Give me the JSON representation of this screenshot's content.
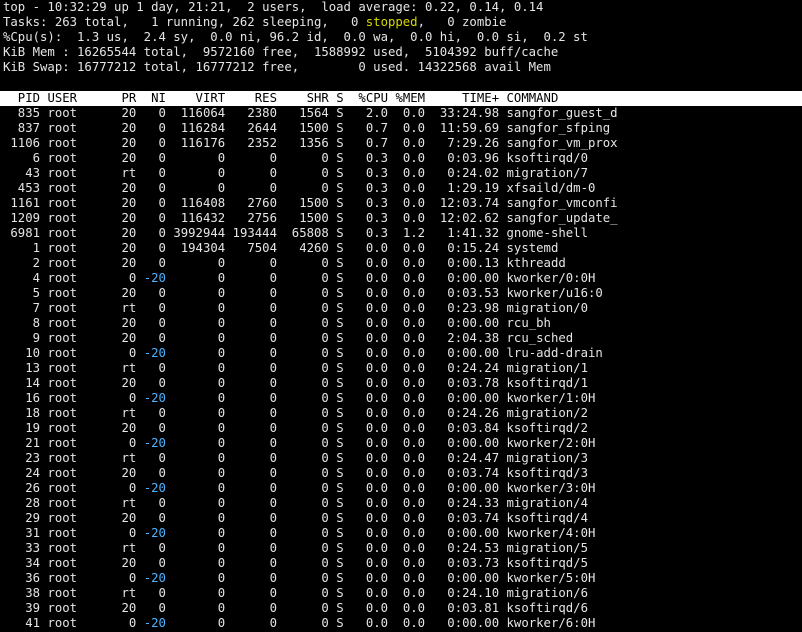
{
  "summary": {
    "line1": "top - 10:32:29 up 1 day, 21:21,  2 users,  load average: 0.22, 0.14, 0.14",
    "tasks_pre": "Tasks: 263 total,   1 running, 262 sleeping,   0 ",
    "tasks_stopped": "stopped",
    "tasks_post": ",   0 zombie",
    "cpu": "%Cpu(s):  1.3 us,  2.4 sy,  0.0 ni, 96.2 id,  0.0 wa,  0.0 hi,  0.0 si,  0.2 st",
    "mem": "KiB Mem : 16265544 total,  9572160 free,  1588992 used,  5104392 buff/cache",
    "swap": "KiB Swap: 16777212 total, 16777212 free,        0 used. 14322568 avail Mem"
  },
  "colors": {
    "stopped": "#d8d800",
    "negative_nice": "#4fb3ff",
    "header_bg": "#ffffff",
    "background": "#000000",
    "text": "#e5e5e5"
  },
  "columns": [
    "PID",
    "USER",
    "PR",
    "NI",
    "VIRT",
    "RES",
    "SHR",
    "S",
    "%CPU",
    "%MEM",
    "TIME+",
    "COMMAND"
  ],
  "processes": [
    {
      "pid": "835",
      "user": "root",
      "pr": "20",
      "ni": "0",
      "virt": "116064",
      "res": "2380",
      "shr": "1564",
      "s": "S",
      "cpu": "2.0",
      "mem": "0.0",
      "time": "33:24.98",
      "cmd": "sangfor_guest_d"
    },
    {
      "pid": "837",
      "user": "root",
      "pr": "20",
      "ni": "0",
      "virt": "116284",
      "res": "2644",
      "shr": "1500",
      "s": "S",
      "cpu": "0.7",
      "mem": "0.0",
      "time": "11:59.69",
      "cmd": "sangfor_sfping"
    },
    {
      "pid": "1106",
      "user": "root",
      "pr": "20",
      "ni": "0",
      "virt": "116176",
      "res": "2352",
      "shr": "1356",
      "s": "S",
      "cpu": "0.7",
      "mem": "0.0",
      "time": "7:29.26",
      "cmd": "sangfor_vm_prox"
    },
    {
      "pid": "6",
      "user": "root",
      "pr": "20",
      "ni": "0",
      "virt": "0",
      "res": "0",
      "shr": "0",
      "s": "S",
      "cpu": "0.3",
      "mem": "0.0",
      "time": "0:03.96",
      "cmd": "ksoftirqd/0"
    },
    {
      "pid": "43",
      "user": "root",
      "pr": "rt",
      "ni": "0",
      "virt": "0",
      "res": "0",
      "shr": "0",
      "s": "S",
      "cpu": "0.3",
      "mem": "0.0",
      "time": "0:24.02",
      "cmd": "migration/7"
    },
    {
      "pid": "453",
      "user": "root",
      "pr": "20",
      "ni": "0",
      "virt": "0",
      "res": "0",
      "shr": "0",
      "s": "S",
      "cpu": "0.3",
      "mem": "0.0",
      "time": "1:29.19",
      "cmd": "xfsaild/dm-0"
    },
    {
      "pid": "1161",
      "user": "root",
      "pr": "20",
      "ni": "0",
      "virt": "116408",
      "res": "2760",
      "shr": "1500",
      "s": "S",
      "cpu": "0.3",
      "mem": "0.0",
      "time": "12:03.74",
      "cmd": "sangfor_vmconfi"
    },
    {
      "pid": "1209",
      "user": "root",
      "pr": "20",
      "ni": "0",
      "virt": "116432",
      "res": "2756",
      "shr": "1500",
      "s": "S",
      "cpu": "0.3",
      "mem": "0.0",
      "time": "12:02.62",
      "cmd": "sangfor_update_"
    },
    {
      "pid": "6981",
      "user": "root",
      "pr": "20",
      "ni": "0",
      "virt": "3992944",
      "res": "193444",
      "shr": "65808",
      "s": "S",
      "cpu": "0.3",
      "mem": "1.2",
      "time": "1:41.32",
      "cmd": "gnome-shell"
    },
    {
      "pid": "1",
      "user": "root",
      "pr": "20",
      "ni": "0",
      "virt": "194304",
      "res": "7504",
      "shr": "4260",
      "s": "S",
      "cpu": "0.0",
      "mem": "0.0",
      "time": "0:15.24",
      "cmd": "systemd"
    },
    {
      "pid": "2",
      "user": "root",
      "pr": "20",
      "ni": "0",
      "virt": "0",
      "res": "0",
      "shr": "0",
      "s": "S",
      "cpu": "0.0",
      "mem": "0.0",
      "time": "0:00.13",
      "cmd": "kthreadd"
    },
    {
      "pid": "4",
      "user": "root",
      "pr": "0",
      "ni": "-20",
      "virt": "0",
      "res": "0",
      "shr": "0",
      "s": "S",
      "cpu": "0.0",
      "mem": "0.0",
      "time": "0:00.00",
      "cmd": "kworker/0:0H"
    },
    {
      "pid": "5",
      "user": "root",
      "pr": "20",
      "ni": "0",
      "virt": "0",
      "res": "0",
      "shr": "0",
      "s": "S",
      "cpu": "0.0",
      "mem": "0.0",
      "time": "0:03.53",
      "cmd": "kworker/u16:0"
    },
    {
      "pid": "7",
      "user": "root",
      "pr": "rt",
      "ni": "0",
      "virt": "0",
      "res": "0",
      "shr": "0",
      "s": "S",
      "cpu": "0.0",
      "mem": "0.0",
      "time": "0:23.98",
      "cmd": "migration/0"
    },
    {
      "pid": "8",
      "user": "root",
      "pr": "20",
      "ni": "0",
      "virt": "0",
      "res": "0",
      "shr": "0",
      "s": "S",
      "cpu": "0.0",
      "mem": "0.0",
      "time": "0:00.00",
      "cmd": "rcu_bh"
    },
    {
      "pid": "9",
      "user": "root",
      "pr": "20",
      "ni": "0",
      "virt": "0",
      "res": "0",
      "shr": "0",
      "s": "S",
      "cpu": "0.0",
      "mem": "0.0",
      "time": "2:04.38",
      "cmd": "rcu_sched"
    },
    {
      "pid": "10",
      "user": "root",
      "pr": "0",
      "ni": "-20",
      "virt": "0",
      "res": "0",
      "shr": "0",
      "s": "S",
      "cpu": "0.0",
      "mem": "0.0",
      "time": "0:00.00",
      "cmd": "lru-add-drain"
    },
    {
      "pid": "13",
      "user": "root",
      "pr": "rt",
      "ni": "0",
      "virt": "0",
      "res": "0",
      "shr": "0",
      "s": "S",
      "cpu": "0.0",
      "mem": "0.0",
      "time": "0:24.24",
      "cmd": "migration/1"
    },
    {
      "pid": "14",
      "user": "root",
      "pr": "20",
      "ni": "0",
      "virt": "0",
      "res": "0",
      "shr": "0",
      "s": "S",
      "cpu": "0.0",
      "mem": "0.0",
      "time": "0:03.78",
      "cmd": "ksoftirqd/1"
    },
    {
      "pid": "16",
      "user": "root",
      "pr": "0",
      "ni": "-20",
      "virt": "0",
      "res": "0",
      "shr": "0",
      "s": "S",
      "cpu": "0.0",
      "mem": "0.0",
      "time": "0:00.00",
      "cmd": "kworker/1:0H"
    },
    {
      "pid": "18",
      "user": "root",
      "pr": "rt",
      "ni": "0",
      "virt": "0",
      "res": "0",
      "shr": "0",
      "s": "S",
      "cpu": "0.0",
      "mem": "0.0",
      "time": "0:24.26",
      "cmd": "migration/2"
    },
    {
      "pid": "19",
      "user": "root",
      "pr": "20",
      "ni": "0",
      "virt": "0",
      "res": "0",
      "shr": "0",
      "s": "S",
      "cpu": "0.0",
      "mem": "0.0",
      "time": "0:03.84",
      "cmd": "ksoftirqd/2"
    },
    {
      "pid": "21",
      "user": "root",
      "pr": "0",
      "ni": "-20",
      "virt": "0",
      "res": "0",
      "shr": "0",
      "s": "S",
      "cpu": "0.0",
      "mem": "0.0",
      "time": "0:00.00",
      "cmd": "kworker/2:0H"
    },
    {
      "pid": "23",
      "user": "root",
      "pr": "rt",
      "ni": "0",
      "virt": "0",
      "res": "0",
      "shr": "0",
      "s": "S",
      "cpu": "0.0",
      "mem": "0.0",
      "time": "0:24.47",
      "cmd": "migration/3"
    },
    {
      "pid": "24",
      "user": "root",
      "pr": "20",
      "ni": "0",
      "virt": "0",
      "res": "0",
      "shr": "0",
      "s": "S",
      "cpu": "0.0",
      "mem": "0.0",
      "time": "0:03.74",
      "cmd": "ksoftirqd/3"
    },
    {
      "pid": "26",
      "user": "root",
      "pr": "0",
      "ni": "-20",
      "virt": "0",
      "res": "0",
      "shr": "0",
      "s": "S",
      "cpu": "0.0",
      "mem": "0.0",
      "time": "0:00.00",
      "cmd": "kworker/3:0H"
    },
    {
      "pid": "28",
      "user": "root",
      "pr": "rt",
      "ni": "0",
      "virt": "0",
      "res": "0",
      "shr": "0",
      "s": "S",
      "cpu": "0.0",
      "mem": "0.0",
      "time": "0:24.33",
      "cmd": "migration/4"
    },
    {
      "pid": "29",
      "user": "root",
      "pr": "20",
      "ni": "0",
      "virt": "0",
      "res": "0",
      "shr": "0",
      "s": "S",
      "cpu": "0.0",
      "mem": "0.0",
      "time": "0:03.74",
      "cmd": "ksoftirqd/4"
    },
    {
      "pid": "31",
      "user": "root",
      "pr": "0",
      "ni": "-20",
      "virt": "0",
      "res": "0",
      "shr": "0",
      "s": "S",
      "cpu": "0.0",
      "mem": "0.0",
      "time": "0:00.00",
      "cmd": "kworker/4:0H"
    },
    {
      "pid": "33",
      "user": "root",
      "pr": "rt",
      "ni": "0",
      "virt": "0",
      "res": "0",
      "shr": "0",
      "s": "S",
      "cpu": "0.0",
      "mem": "0.0",
      "time": "0:24.53",
      "cmd": "migration/5"
    },
    {
      "pid": "34",
      "user": "root",
      "pr": "20",
      "ni": "0",
      "virt": "0",
      "res": "0",
      "shr": "0",
      "s": "S",
      "cpu": "0.0",
      "mem": "0.0",
      "time": "0:03.73",
      "cmd": "ksoftirqd/5"
    },
    {
      "pid": "36",
      "user": "root",
      "pr": "0",
      "ni": "-20",
      "virt": "0",
      "res": "0",
      "shr": "0",
      "s": "S",
      "cpu": "0.0",
      "mem": "0.0",
      "time": "0:00.00",
      "cmd": "kworker/5:0H"
    },
    {
      "pid": "38",
      "user": "root",
      "pr": "rt",
      "ni": "0",
      "virt": "0",
      "res": "0",
      "shr": "0",
      "s": "S",
      "cpu": "0.0",
      "mem": "0.0",
      "time": "0:24.10",
      "cmd": "migration/6"
    },
    {
      "pid": "39",
      "user": "root",
      "pr": "20",
      "ni": "0",
      "virt": "0",
      "res": "0",
      "shr": "0",
      "s": "S",
      "cpu": "0.0",
      "mem": "0.0",
      "time": "0:03.81",
      "cmd": "ksoftirqd/6"
    },
    {
      "pid": "41",
      "user": "root",
      "pr": "0",
      "ni": "-20",
      "virt": "0",
      "res": "0",
      "shr": "0",
      "s": "S",
      "cpu": "0.0",
      "mem": "0.0",
      "time": "0:00.00",
      "cmd": "kworker/6:0H"
    }
  ]
}
